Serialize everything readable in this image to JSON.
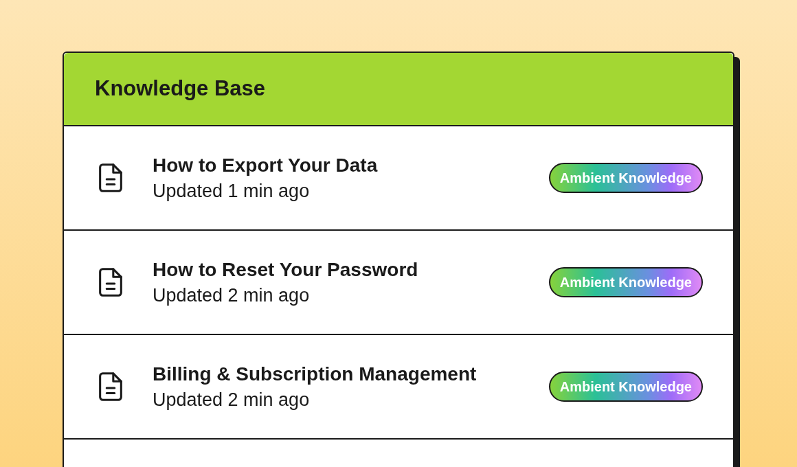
{
  "panel": {
    "title": "Knowledge Base"
  },
  "articles": [
    {
      "title": "How to Export Your Data",
      "updated": "Updated 1 min ago",
      "tag": "Ambient Knowledge"
    },
    {
      "title": "How to Reset Your Password",
      "updated": "Updated 2 min ago",
      "tag": "Ambient Knowledge"
    },
    {
      "title": "Billing & Subscription Management",
      "updated": "Updated 2 min ago",
      "tag": "Ambient Knowledge"
    }
  ]
}
